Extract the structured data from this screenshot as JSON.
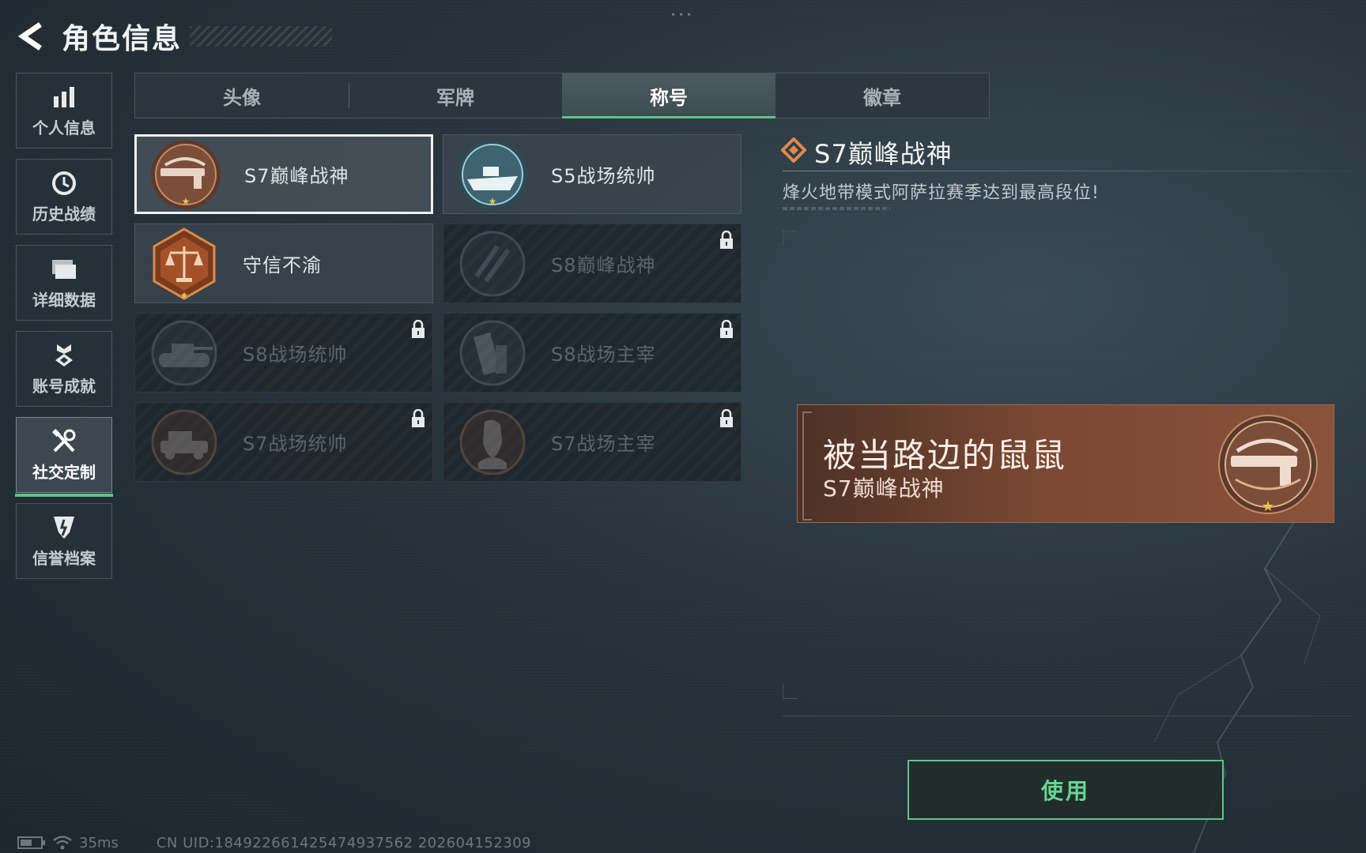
{
  "header": {
    "title": "角色信息"
  },
  "sidebar": {
    "items": [
      {
        "label": "个人信息",
        "icon": "bar-chart-icon",
        "active": false
      },
      {
        "label": "历史战绩",
        "icon": "history-icon",
        "active": false
      },
      {
        "label": "详细数据",
        "icon": "folder-icon",
        "active": false
      },
      {
        "label": "账号成就",
        "icon": "achievement-icon",
        "active": false
      },
      {
        "label": "社交定制",
        "icon": "tools-icon",
        "active": true
      },
      {
        "label": "信誉档案",
        "icon": "shield-icon",
        "active": false
      }
    ]
  },
  "tabs": [
    {
      "label": "头像",
      "active": false
    },
    {
      "label": "军牌",
      "active": false
    },
    {
      "label": "称号",
      "active": true
    },
    {
      "label": "徽章",
      "active": false
    }
  ],
  "titles": [
    {
      "label": "S7巅峰战神",
      "badge": "rifle-badge",
      "locked": false,
      "selected": true
    },
    {
      "label": "S5战场统帅",
      "badge": "boat-badge",
      "locked": false,
      "selected": false
    },
    {
      "label": "守信不渝",
      "badge": "scales-badge",
      "locked": false,
      "selected": false
    },
    {
      "label": "S8巅峰战神",
      "badge": "slash-badge",
      "locked": true,
      "selected": false
    },
    {
      "label": "S8战场统帅",
      "badge": "tank-badge",
      "locked": true,
      "selected": false
    },
    {
      "label": "S8战场主宰",
      "badge": "building-badge",
      "locked": true,
      "selected": false
    },
    {
      "label": "S7战场统帅",
      "badge": "vehicle-badge",
      "locked": true,
      "selected": false
    },
    {
      "label": "S7战场主宰",
      "badge": "soldier-badge",
      "locked": true,
      "selected": false
    }
  ],
  "detail": {
    "title": "S7巅峰战神",
    "description": "烽火地带模式阿萨拉赛季达到最高段位!"
  },
  "preview": {
    "player_name": "被当路边的鼠鼠",
    "title": "S7巅峰战神"
  },
  "actions": {
    "use_label": "使用"
  },
  "status": {
    "ping": "35ms",
    "uid": "CN UID:18492266142547493756​2 202604152309"
  },
  "colors": {
    "accent": "#5ec48a",
    "banner": "#7a4833",
    "badge_gold": "#e0a45c"
  }
}
